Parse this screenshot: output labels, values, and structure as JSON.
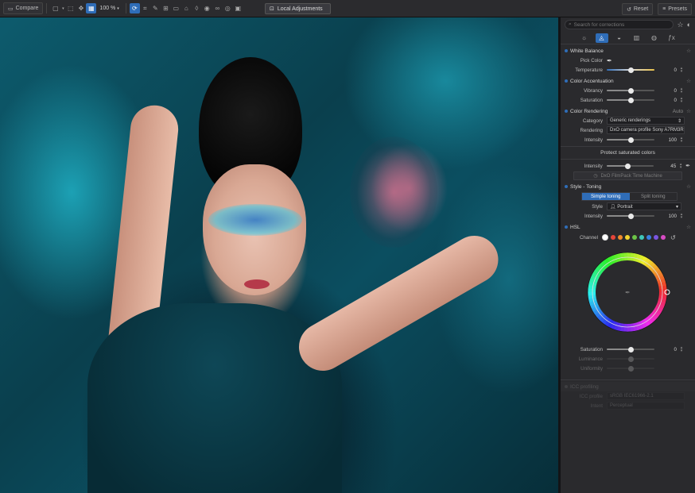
{
  "toolbar": {
    "compare_label": "Compare",
    "zoom": "100 %",
    "local_adjustments_label": "Local Adjustments",
    "reset_label": "Reset",
    "presets_label": "Presets"
  },
  "panel": {
    "search_placeholder": "Search for corrections",
    "white_balance": {
      "title": "White Balance",
      "pick_color_label": "Pick Color",
      "temperature_label": "Temperature",
      "temperature_value": "0",
      "temperature_position": 0.5
    },
    "color_accentuation": {
      "title": "Color Accentuation",
      "vibrancy_label": "Vibrancy",
      "vibrancy_value": "0",
      "vibrancy_position": 0.5,
      "saturation_label": "Saturation",
      "saturation_value": "0",
      "saturation_position": 0.5
    },
    "color_rendering": {
      "title": "Color Rendering",
      "mode": "Auto",
      "category_label": "Category",
      "category_value": "Generic renderings",
      "rendering_label": "Rendering",
      "rendering_value": "DxO camera profile Sony A7RM3R",
      "intensity_label": "Intensity",
      "intensity_value": "100",
      "intensity_position": 0.5,
      "protect_title": "Protect saturated colors",
      "protect_intensity_label": "Intensity",
      "protect_intensity_value": "45",
      "protect_intensity_position": 0.45,
      "filmpack_button": "DxO FilmPack Time Machine"
    },
    "style_toning": {
      "title": "Style - Toning",
      "simple_toning": "Simple toning",
      "split_toning": "Split toning",
      "style_label": "Style",
      "style_value": "Portrait",
      "intensity_label": "Intensity",
      "intensity_value": "100",
      "intensity_position": 0.5
    },
    "hsl": {
      "title": "HSL",
      "channel_label": "Channel",
      "channel_colors": [
        "#ffffff",
        "#e5453a",
        "#f08a2c",
        "#f1d42f",
        "#6cc447",
        "#3fc7b8",
        "#3a7fe0",
        "#7a55e0",
        "#d84bc4"
      ],
      "saturation_label": "Saturation",
      "saturation_value": "0",
      "saturation_position": 0.5,
      "luminance_label": "Luminance",
      "uniformity_label": "Uniformity"
    },
    "ghost_section": {
      "title": "ICC profiling",
      "icc_label": "ICC profile",
      "icc_value": "sRGB IEC61966-2.1",
      "intent_label": "Intent",
      "intent_value": "Perceptual"
    }
  },
  "colors": {
    "accent": "#2f6db8",
    "panel_bg": "#2a2a2d",
    "toolbar_bg": "#2b2b2e"
  }
}
